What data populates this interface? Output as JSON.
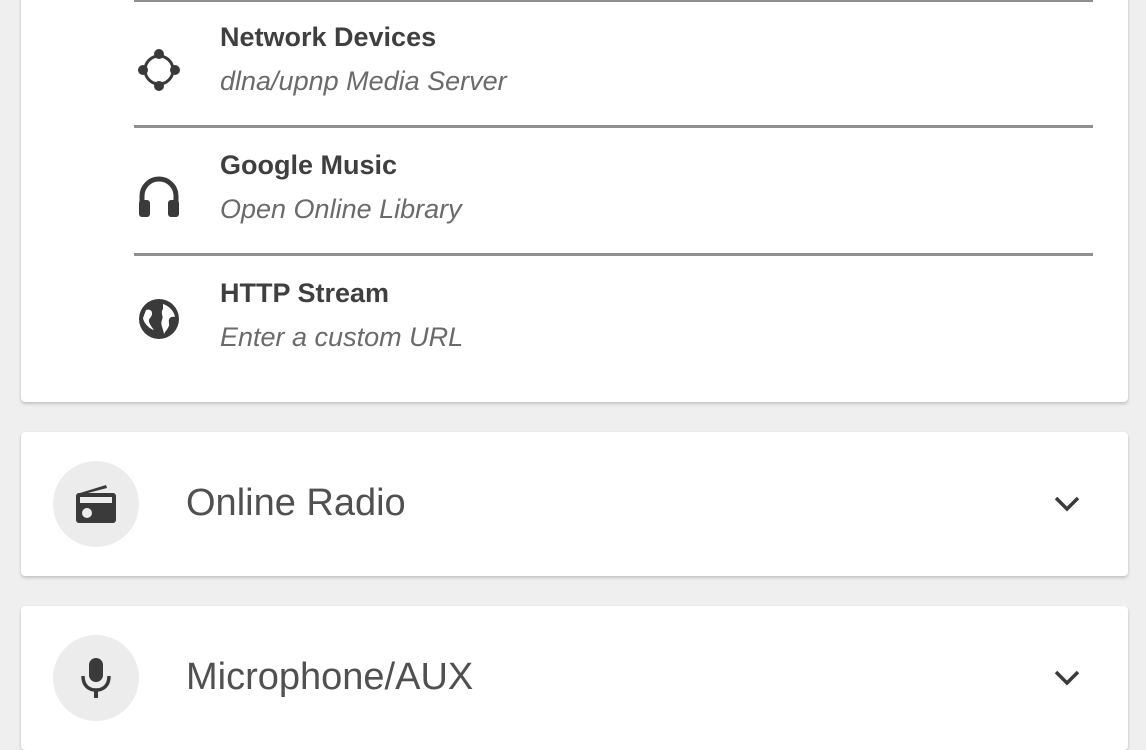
{
  "sources": {
    "items": [
      {
        "title": "Network Devices",
        "subtitle": "dlna/upnp Media Server",
        "icon": "network-devices-icon"
      },
      {
        "title": "Google Music",
        "subtitle": "Open Online Library",
        "icon": "headphones-icon"
      },
      {
        "title": "HTTP Stream",
        "subtitle": "Enter a custom URL",
        "icon": "globe-icon"
      }
    ]
  },
  "sections": [
    {
      "label": "Online Radio",
      "icon": "radio-icon",
      "expand_icon": "chevron-down-icon"
    },
    {
      "label": "Microphone/AUX",
      "icon": "microphone-icon",
      "expand_icon": "chevron-down-icon"
    }
  ],
  "colors": {
    "background": "#efefef",
    "card": "#ffffff",
    "title_text": "#3f3f3f",
    "subtitle_text": "#6a6a6a",
    "icon": "#3a3a3a"
  }
}
